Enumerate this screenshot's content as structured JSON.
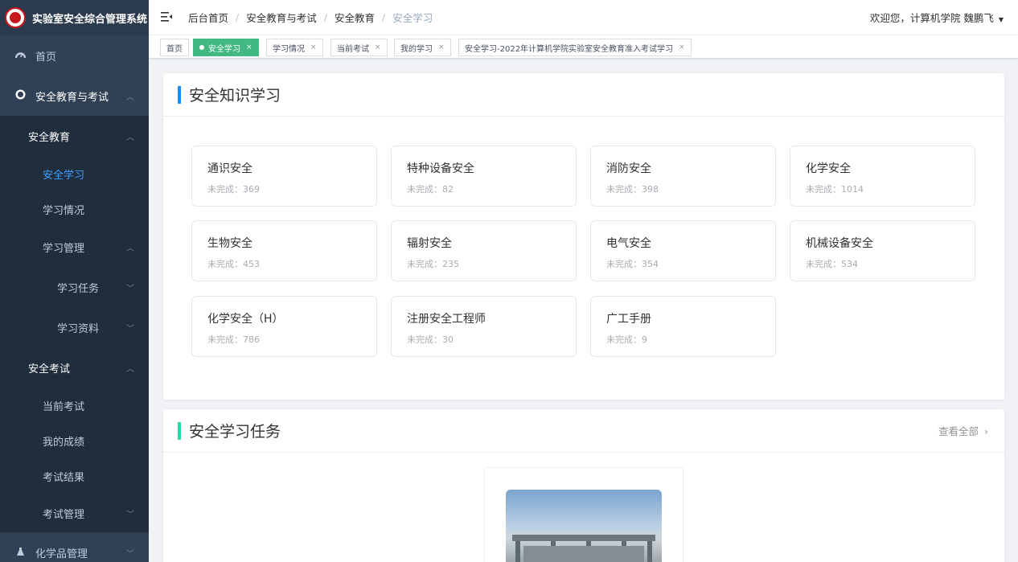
{
  "app": {
    "title": "实验室安全综合管理系统"
  },
  "sidebar": {
    "items": [
      {
        "label": "首页"
      },
      {
        "label": "安全教育与考试"
      },
      {
        "label": "安全教育"
      },
      {
        "label": "安全学习"
      },
      {
        "label": "学习情况"
      },
      {
        "label": "学习管理"
      },
      {
        "label": "学习任务"
      },
      {
        "label": "学习资料"
      },
      {
        "label": "安全考试"
      },
      {
        "label": "当前考试"
      },
      {
        "label": "我的成绩"
      },
      {
        "label": "考试结果"
      },
      {
        "label": "考试管理"
      },
      {
        "label": "化学品管理"
      }
    ],
    "bg_color": "#304156",
    "active_color": "#409eff"
  },
  "header": {
    "breadcrumb": [
      "后台首页",
      "安全教育与考试",
      "安全教育",
      "安全学习"
    ],
    "welcome": "欢迎您，计算机学院 魏鹏飞"
  },
  "tags": [
    {
      "label": "首页"
    },
    {
      "label": "安全学习"
    },
    {
      "label": "学习情况"
    },
    {
      "label": "当前考试"
    },
    {
      "label": "我的学习"
    },
    {
      "label": "安全学习-2022年计算机学院实验室安全教育准入考试学习"
    }
  ],
  "knowledge": {
    "title": "安全知识学习",
    "accent": "#1890ff",
    "categories": [
      {
        "name": "通识安全",
        "stat": "未完成：369"
      },
      {
        "name": "特种设备安全",
        "stat": "未完成：82"
      },
      {
        "name": "消防安全",
        "stat": "未完成：398"
      },
      {
        "name": "化学安全",
        "stat": "未完成：1014"
      },
      {
        "name": "生物安全",
        "stat": "未完成：453"
      },
      {
        "name": "辐射安全",
        "stat": "未完成：235"
      },
      {
        "name": "电气安全",
        "stat": "未完成：354"
      },
      {
        "name": "机械设备安全",
        "stat": "未完成：534"
      },
      {
        "name": "化学安全（H）",
        "stat": "未完成：786"
      },
      {
        "name": "注册安全工程师",
        "stat": "未完成：30"
      },
      {
        "name": "广工手册",
        "stat": "未完成：9"
      }
    ]
  },
  "tasks": {
    "title": "安全学习任务",
    "view_all": "查看全部",
    "accent": "#2fd3a8"
  }
}
